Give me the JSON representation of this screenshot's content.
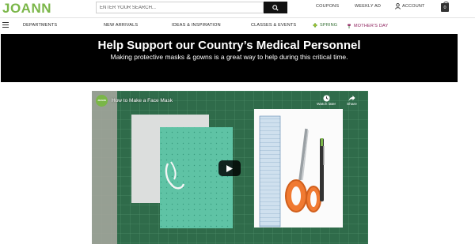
{
  "header": {
    "logo": "JOANN",
    "search_placeholder": "ENTER YOUR SEARCH...",
    "links": {
      "coupons": "COUPONS",
      "weekly_ad": "WEEKLY AD",
      "account": "ACCOUNT"
    },
    "bag_count": "0"
  },
  "nav": {
    "departments": "DEPARTMENTS",
    "new_arrivals": "NEW ARRIVALS",
    "ideas": "IDEAS & INSPIRATION",
    "classes": "CLASSES & EVENTS",
    "spring": "SPRING",
    "mothers_day": "MOTHER'S DAY"
  },
  "banner": {
    "title": "Help Support our Country’s Medical Personnel",
    "subtitle": "Making protective masks & gowns is a great way to help during this critical time."
  },
  "video": {
    "channel_logo": "JOANN",
    "title": "How to Make a Face Mask",
    "watch_later": "Watch later",
    "share": "Share"
  },
  "colors": {
    "brand_green": "#7ab648",
    "spring_green": "#2f6b2f",
    "mothers_day_magenta": "#8d1f5c",
    "banner_bg": "#000000"
  }
}
